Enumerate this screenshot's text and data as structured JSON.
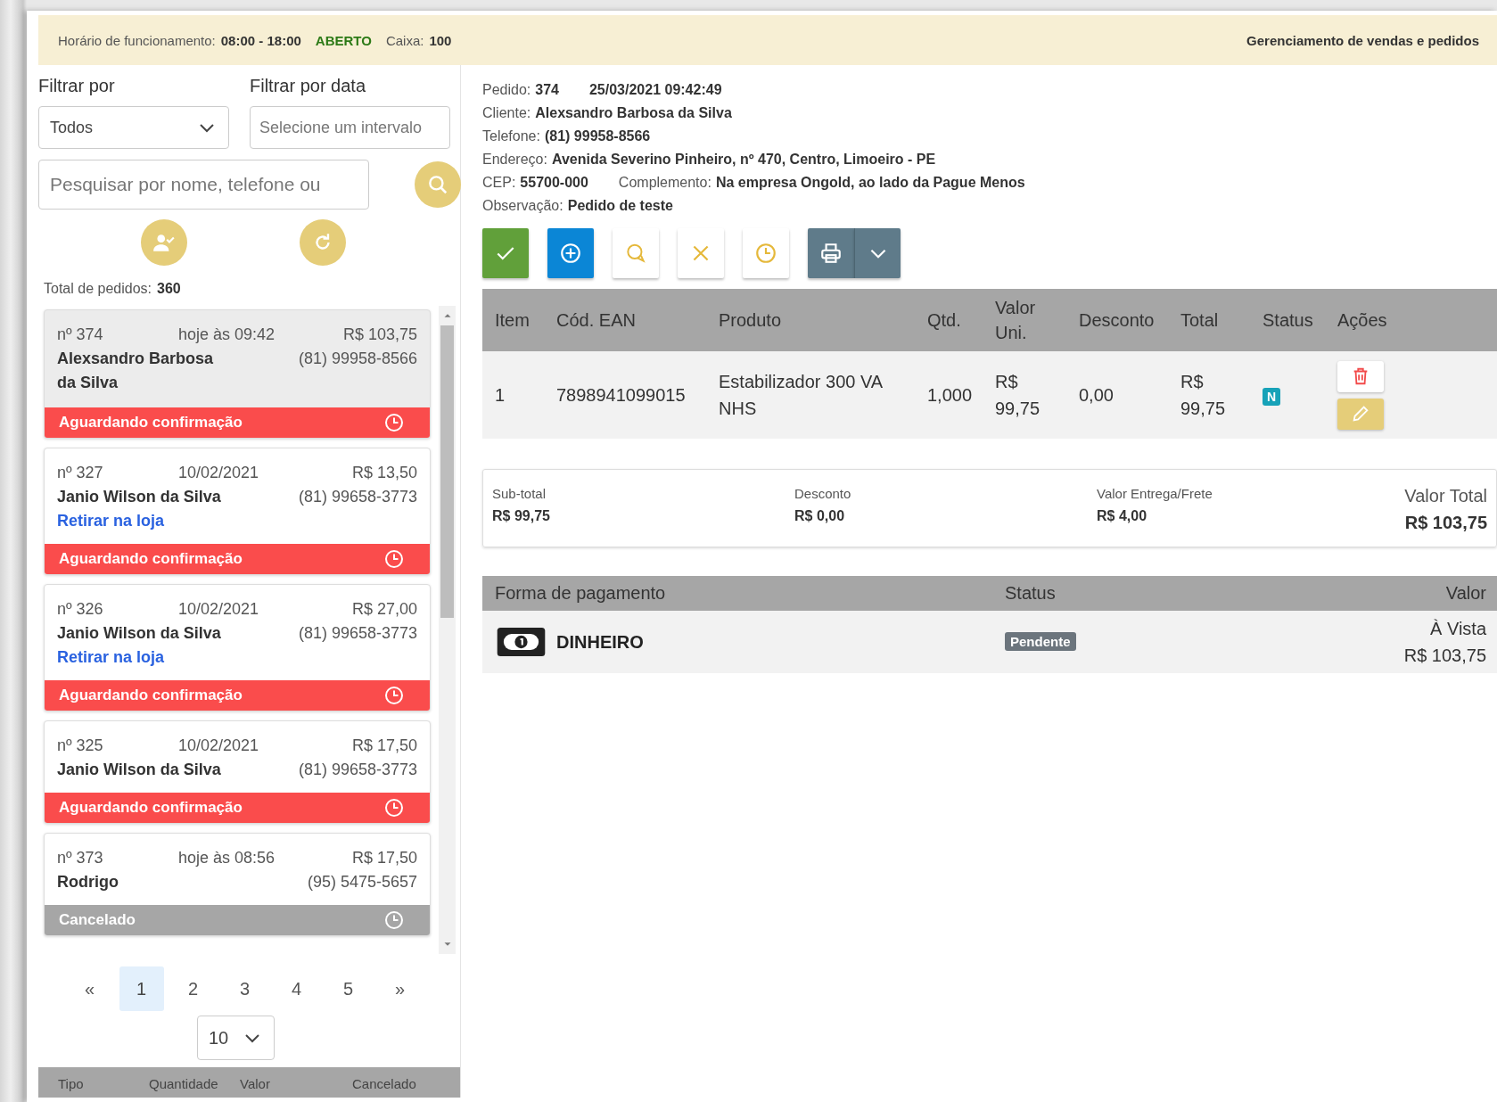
{
  "top_bar": {
    "hours_label": "Horário de funcionamento:",
    "hours": "08:00 - 18:00",
    "open_status": "ABERTO",
    "is_open": true,
    "cash_label": "Caixa:",
    "cash": "100",
    "title": "Gerenciamento de vendas e pedidos"
  },
  "filters": {
    "filter_label": "Filtrar por",
    "filter_value": "Todos",
    "date_label": "Filtrar por data",
    "date_placeholder": "Selecione um intervalo",
    "search_placeholder": "Pesquisar por nome, telefone ou"
  },
  "total": {
    "label": "Total de pedidos:",
    "value": "360"
  },
  "orders": [
    {
      "number": "nº 374",
      "date": "hoje às 09:42",
      "price": "R$ 103,75",
      "name": "Alexsandro Barbosa da Silva",
      "phone": "(81) 99958-8566",
      "status": "Aguardando confirmação",
      "kind": "waiting",
      "selected": true
    },
    {
      "number": "nº 327",
      "date": "10/02/2021",
      "price": "R$ 13,50",
      "name": "Janio Wilson da Silva",
      "phone": "(81) 99658-3773",
      "pickup": "Retirar na loja",
      "status": "Aguardando confirmação",
      "kind": "waiting",
      "selected": false
    },
    {
      "number": "nº 326",
      "date": "10/02/2021",
      "price": "R$ 27,00",
      "name": "Janio Wilson da Silva",
      "phone": "(81) 99658-3773",
      "pickup": "Retirar na loja",
      "status": "Aguardando confirmação",
      "kind": "waiting",
      "selected": false
    },
    {
      "number": "nº 325",
      "date": "10/02/2021",
      "price": "R$ 17,50",
      "name": "Janio Wilson da Silva",
      "phone": "(81) 99658-3773",
      "status": "Aguardando confirmação",
      "kind": "waiting",
      "selected": false
    },
    {
      "number": "nº 373",
      "date": "hoje às 08:56",
      "price": "R$ 17,50",
      "name": "Rodrigo",
      "phone": "(95) 5475-5657",
      "status": "Cancelado",
      "kind": "cancelled",
      "selected": false
    }
  ],
  "pagination": {
    "first": "«",
    "last": "»",
    "pages": [
      {
        "label": "1",
        "selected": true
      },
      {
        "label": "2",
        "selected": false
      },
      {
        "label": "3",
        "selected": false
      },
      {
        "label": "4",
        "selected": false
      },
      {
        "label": "5",
        "selected": false
      }
    ],
    "page_size": "10"
  },
  "summary_table": {
    "columns": [
      "Tipo",
      "Quantidade",
      "Valor",
      "Cancelado"
    ]
  },
  "detail": {
    "lines": [
      [
        {
          "label": "Pedido:",
          "value": "374"
        },
        {
          "value": "25/03/2021 09:42:49"
        }
      ],
      [
        {
          "label": "Cliente:",
          "value": "Alexsandro Barbosa da Silva"
        }
      ],
      [
        {
          "label": "Telefone:",
          "value": "(81) 99958-8566"
        }
      ],
      [
        {
          "label": "Endereço:",
          "value": "Avenida Severino Pinheiro, nº 470, Centro, Limoeiro - PE"
        }
      ],
      [
        {
          "label": "CEP:",
          "value": "55700-000"
        },
        {
          "label": "Complemento:",
          "value": "Na empresa Ongold, ao lado da Pague Menos"
        }
      ],
      [
        {
          "label": "Observação:",
          "value": "Pedido de teste"
        }
      ]
    ]
  },
  "actions": [
    {
      "kind": "confirm"
    },
    {
      "kind": "add"
    },
    {
      "kind": "chat"
    },
    {
      "kind": "cancel"
    },
    {
      "kind": "clock"
    },
    {
      "kind": "print"
    }
  ],
  "items_table": {
    "columns": [
      "Item",
      "Cód. EAN",
      "Produto",
      "Qtd.",
      "Valor Uni.",
      "Desconto",
      "Total",
      "Status",
      "Ações"
    ],
    "rows": [
      {
        "item": "1",
        "ean": "7898941099015",
        "product": "Estabilizador 300 VA NHS",
        "qty": "1,000",
        "unit": "R$ 99,75",
        "discount": "0,00",
        "total": "R$ 99,75",
        "status": "N"
      }
    ]
  },
  "totals": [
    {
      "label": "Sub-total",
      "value": "R$ 99,75"
    },
    {
      "label": "Desconto",
      "value": "R$ 0,00"
    },
    {
      "label": "Valor Entrega/Frete",
      "value": "R$ 4,00"
    },
    {
      "label": "Valor Total",
      "value": "R$ 103,75",
      "kind": "grand"
    }
  ],
  "payments": {
    "columns": [
      "Forma de pagamento",
      "Status",
      "Valor"
    ],
    "rows": [
      {
        "method": "DINHEIRO",
        "status": "Pendente",
        "terms": "À Vista",
        "value": "R$ 103,75"
      }
    ]
  }
}
